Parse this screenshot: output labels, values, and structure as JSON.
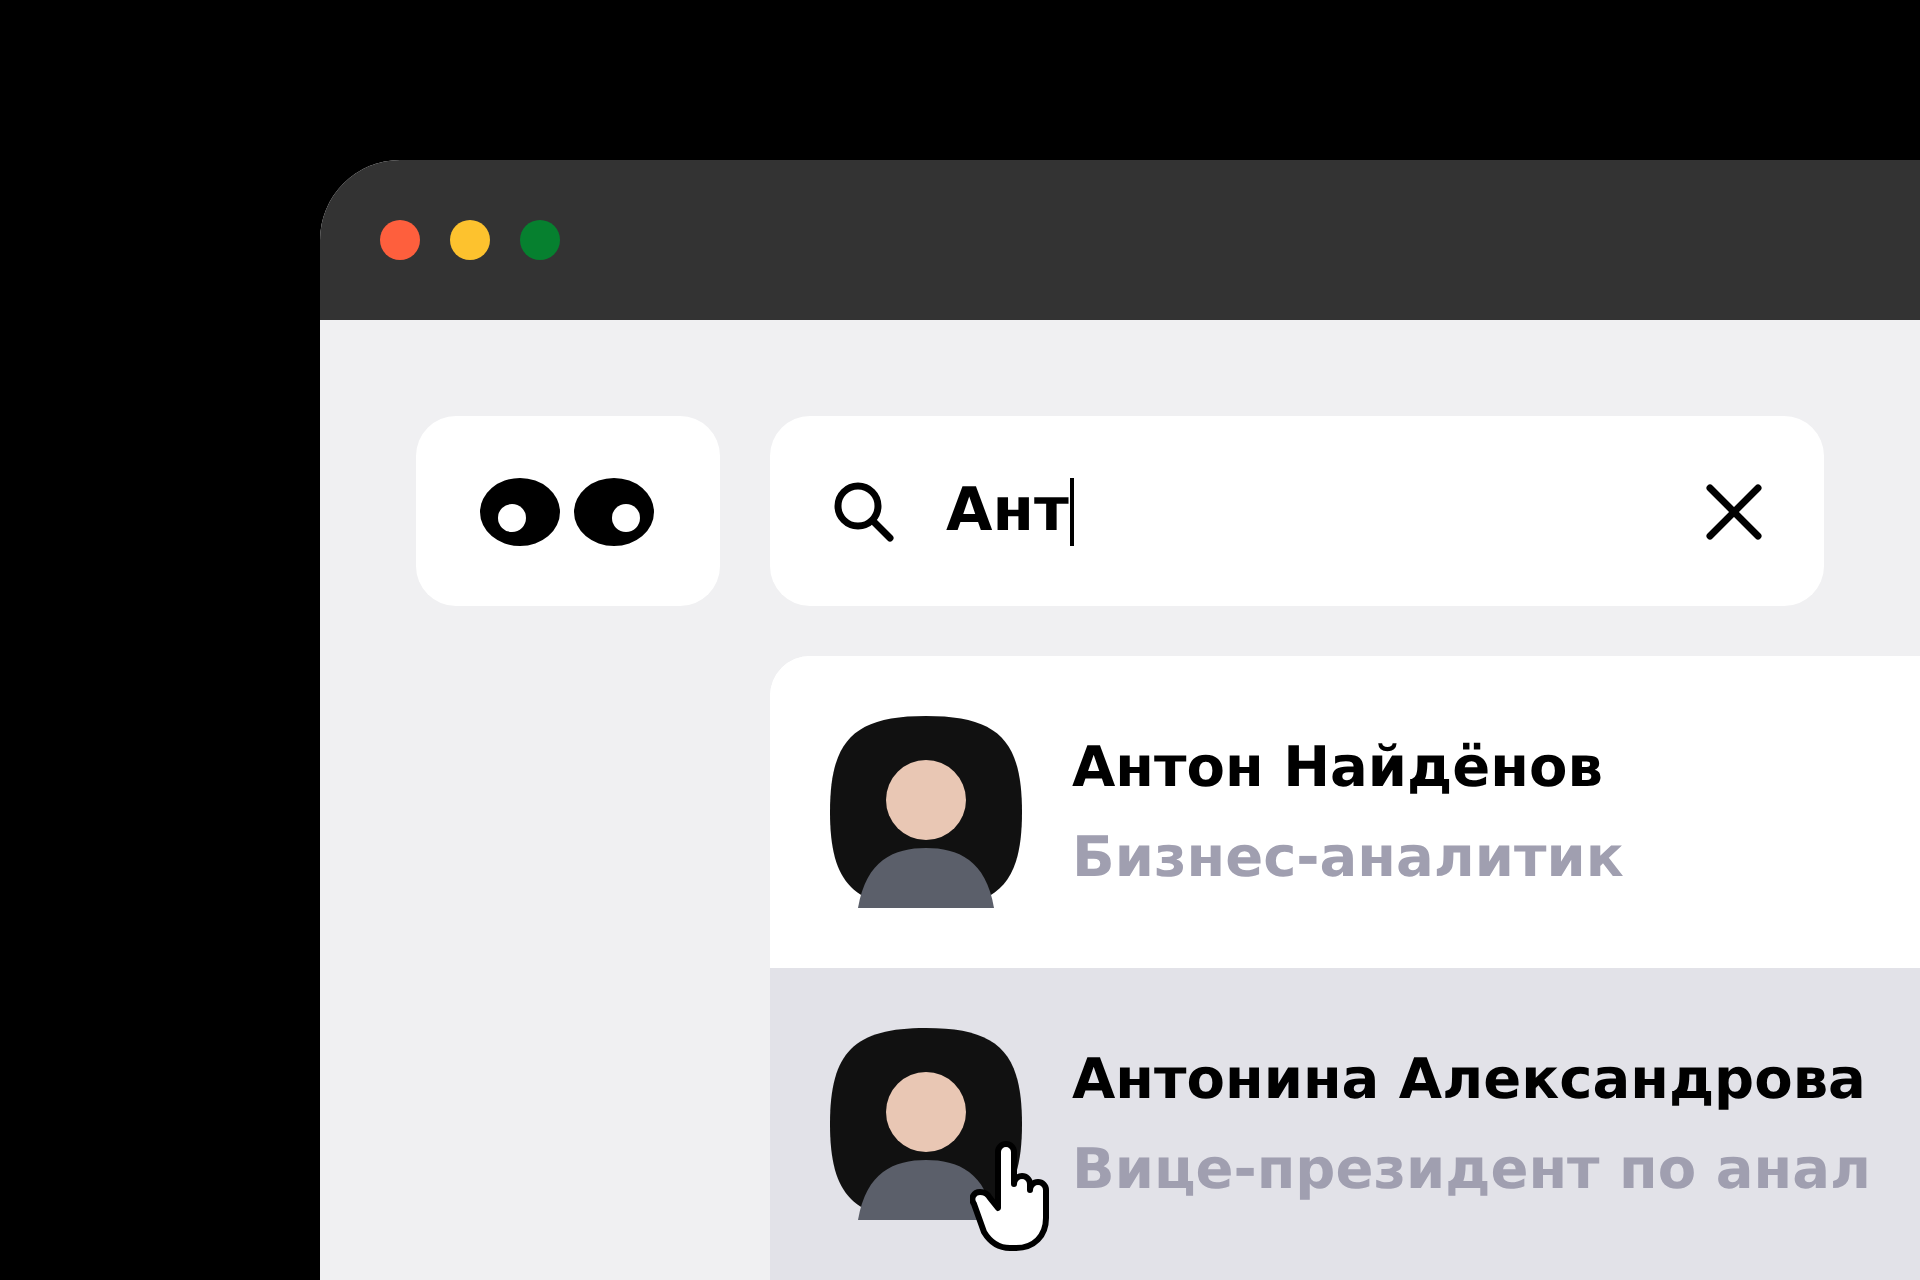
{
  "search": {
    "value": "Ант"
  },
  "results": [
    {
      "name": "Антон Найдёнов",
      "role": "Бизнес-аналитик",
      "selected": false
    },
    {
      "name": "Антонина Александрова",
      "role": "Вице-президент по анал",
      "selected": true
    }
  ]
}
